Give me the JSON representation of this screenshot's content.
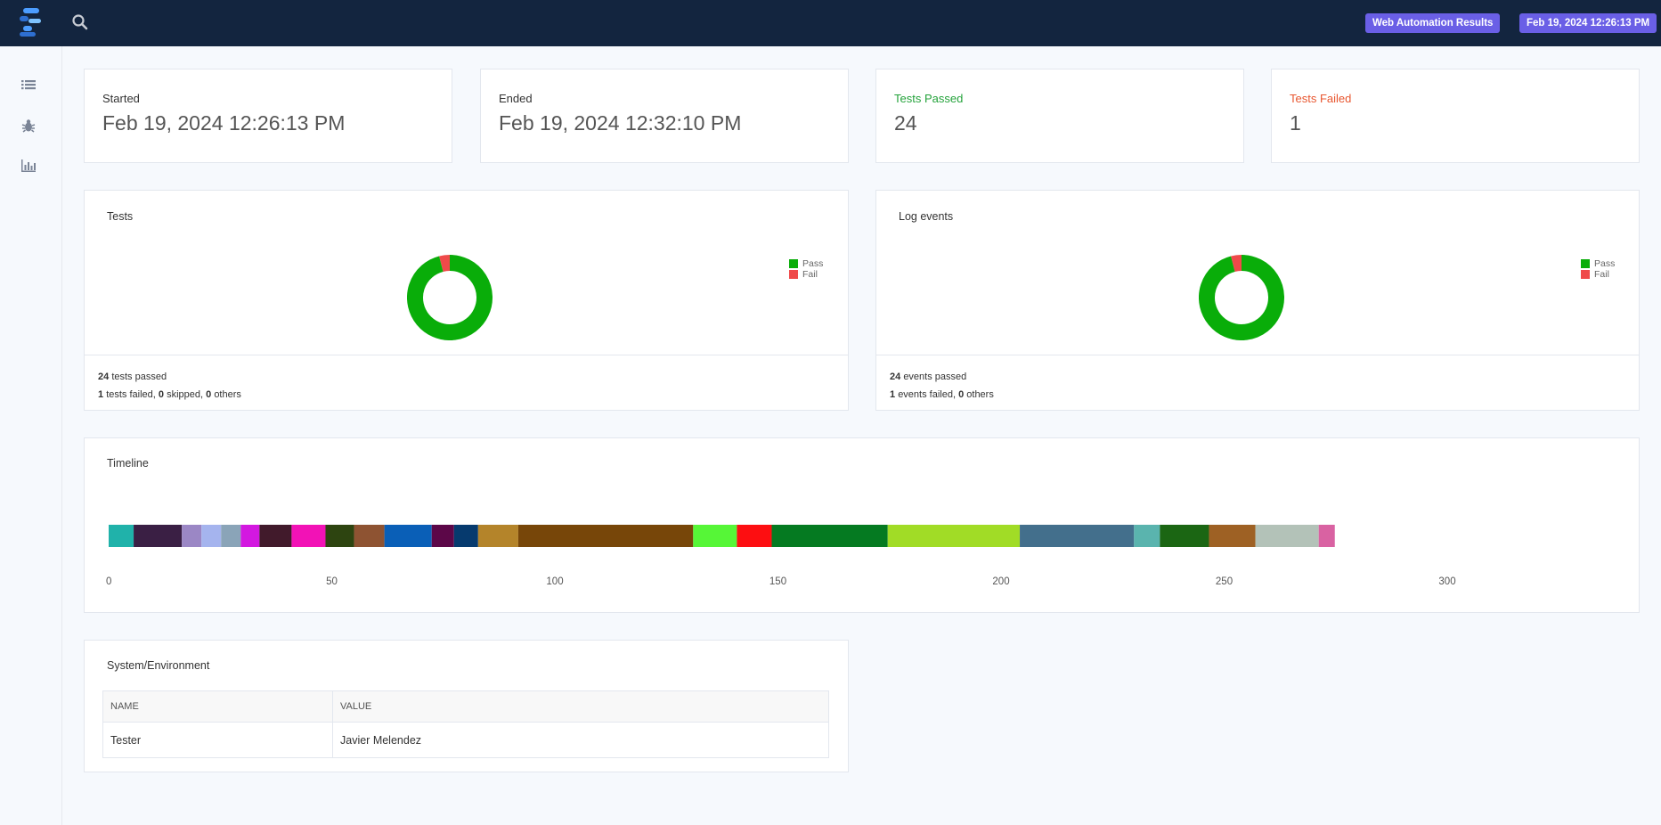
{
  "header": {
    "report_title": "Web Automation Results",
    "report_date": "Feb 19, 2024 12:26:13 PM"
  },
  "sidebar": {
    "items": [
      {
        "icon": "list-icon"
      },
      {
        "icon": "bug-icon"
      },
      {
        "icon": "bar-chart-icon"
      }
    ]
  },
  "stats": {
    "started_label": "Started",
    "started_value": "Feb 19, 2024 12:26:13 PM",
    "ended_label": "Ended",
    "ended_value": "Feb 19, 2024 12:32:10 PM",
    "passed_label": "Tests Passed",
    "passed_value": "24",
    "failed_label": "Tests Failed",
    "failed_value": "1"
  },
  "tests_chart": {
    "title": "Tests",
    "legend_pass": "Pass",
    "legend_fail": "Fail",
    "pass": 24,
    "fail": 1,
    "footer": {
      "passed_count": "24",
      "passed_text": "tests passed",
      "failed_count": "1",
      "failed_text": "tests failed,",
      "skipped_count": "0",
      "skipped_text": "skipped,",
      "others_count": "0",
      "others_text": "others"
    }
  },
  "log_chart": {
    "title": "Log events",
    "legend_pass": "Pass",
    "legend_fail": "Fail",
    "pass": 24,
    "fail": 1,
    "footer": {
      "passed_count": "24",
      "passed_text": "events passed",
      "failed_count": "1",
      "failed_text": "events failed,",
      "others_count": "0",
      "others_text": "others"
    }
  },
  "colors": {
    "pass": "#09ad09",
    "fail": "#ef4a4a",
    "accent_badge": "#6a5fe6",
    "topbar": "#13253f"
  },
  "timeline": {
    "title": "Timeline",
    "axis_ticks": [
      "0",
      "50",
      "100",
      "150",
      "200",
      "250",
      "300"
    ]
  },
  "chart_data": [
    {
      "type": "pie",
      "title": "Tests",
      "categories": [
        "Pass",
        "Fail"
      ],
      "values": [
        24,
        1
      ],
      "colors": [
        "#09ad09",
        "#ef4a4a"
      ],
      "legend": "top-right"
    },
    {
      "type": "pie",
      "title": "Log events",
      "categories": [
        "Pass",
        "Fail"
      ],
      "values": [
        24,
        1
      ],
      "colors": [
        "#09ad09",
        "#ef4a4a"
      ],
      "legend": "top-right"
    },
    {
      "type": "bar",
      "title": "Timeline",
      "orientation": "horizontal-stacked",
      "xlim": [
        0,
        300
      ],
      "segments": [
        {
          "start": 0,
          "end": 5.6,
          "color": "#20b2aa"
        },
        {
          "start": 5.6,
          "end": 16.4,
          "color": "#3a1f44"
        },
        {
          "start": 16.4,
          "end": 20.8,
          "color": "#9b87c5"
        },
        {
          "start": 20.8,
          "end": 25.2,
          "color": "#a5b4ee"
        },
        {
          "start": 25.2,
          "end": 29.6,
          "color": "#8aa4b8"
        },
        {
          "start": 29.6,
          "end": 33.8,
          "color": "#d318e0"
        },
        {
          "start": 33.8,
          "end": 41.0,
          "color": "#411a2b"
        },
        {
          "start": 41.0,
          "end": 48.6,
          "color": "#f212b6"
        },
        {
          "start": 48.6,
          "end": 55.0,
          "color": "#2d4410"
        },
        {
          "start": 55.0,
          "end": 61.8,
          "color": "#8e5332"
        },
        {
          "start": 61.8,
          "end": 72.4,
          "color": "#0a5fb7"
        },
        {
          "start": 72.4,
          "end": 77.4,
          "color": "#5c0748"
        },
        {
          "start": 77.4,
          "end": 82.8,
          "color": "#063a6e"
        },
        {
          "start": 82.8,
          "end": 91.8,
          "color": "#b4842a"
        },
        {
          "start": 91.8,
          "end": 131.0,
          "color": "#774609"
        },
        {
          "start": 131.0,
          "end": 140.8,
          "color": "#56f637"
        },
        {
          "start": 140.8,
          "end": 148.6,
          "color": "#fd0e11"
        },
        {
          "start": 148.6,
          "end": 174.6,
          "color": "#057a21"
        },
        {
          "start": 174.6,
          "end": 204.2,
          "color": "#a1dc26"
        },
        {
          "start": 204.2,
          "end": 229.8,
          "color": "#436f8c"
        },
        {
          "start": 229.8,
          "end": 235.6,
          "color": "#5ab4ae"
        },
        {
          "start": 235.6,
          "end": 246.6,
          "color": "#1b6613"
        },
        {
          "start": 246.6,
          "end": 257.0,
          "color": "#9e6124"
        },
        {
          "start": 257.0,
          "end": 271.2,
          "color": "#b3c2b8"
        },
        {
          "start": 271.2,
          "end": 274.8,
          "color": "#d962a2"
        }
      ],
      "x_ticks": [
        0,
        50,
        100,
        150,
        200,
        250,
        300
      ]
    }
  ],
  "environment": {
    "title": "System/Environment",
    "col_name": "NAME",
    "col_value": "VALUE",
    "rows": [
      {
        "name": "Tester",
        "value": "Javier Melendez"
      }
    ]
  }
}
